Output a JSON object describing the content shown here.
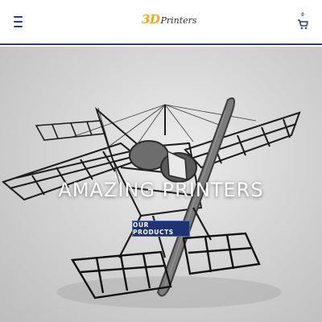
{
  "header": {
    "logo": {
      "prefix": "3D",
      "name": "Printers"
    },
    "cart": {
      "count": "0"
    }
  },
  "hero": {
    "title": "AMAZING PRINTERS",
    "cta_label": "OUR PRODUCTS"
  },
  "colors": {
    "brand_navy": "#1f3372",
    "logo_orange": "#f5a623",
    "hero_background": "#d6d6d6"
  }
}
